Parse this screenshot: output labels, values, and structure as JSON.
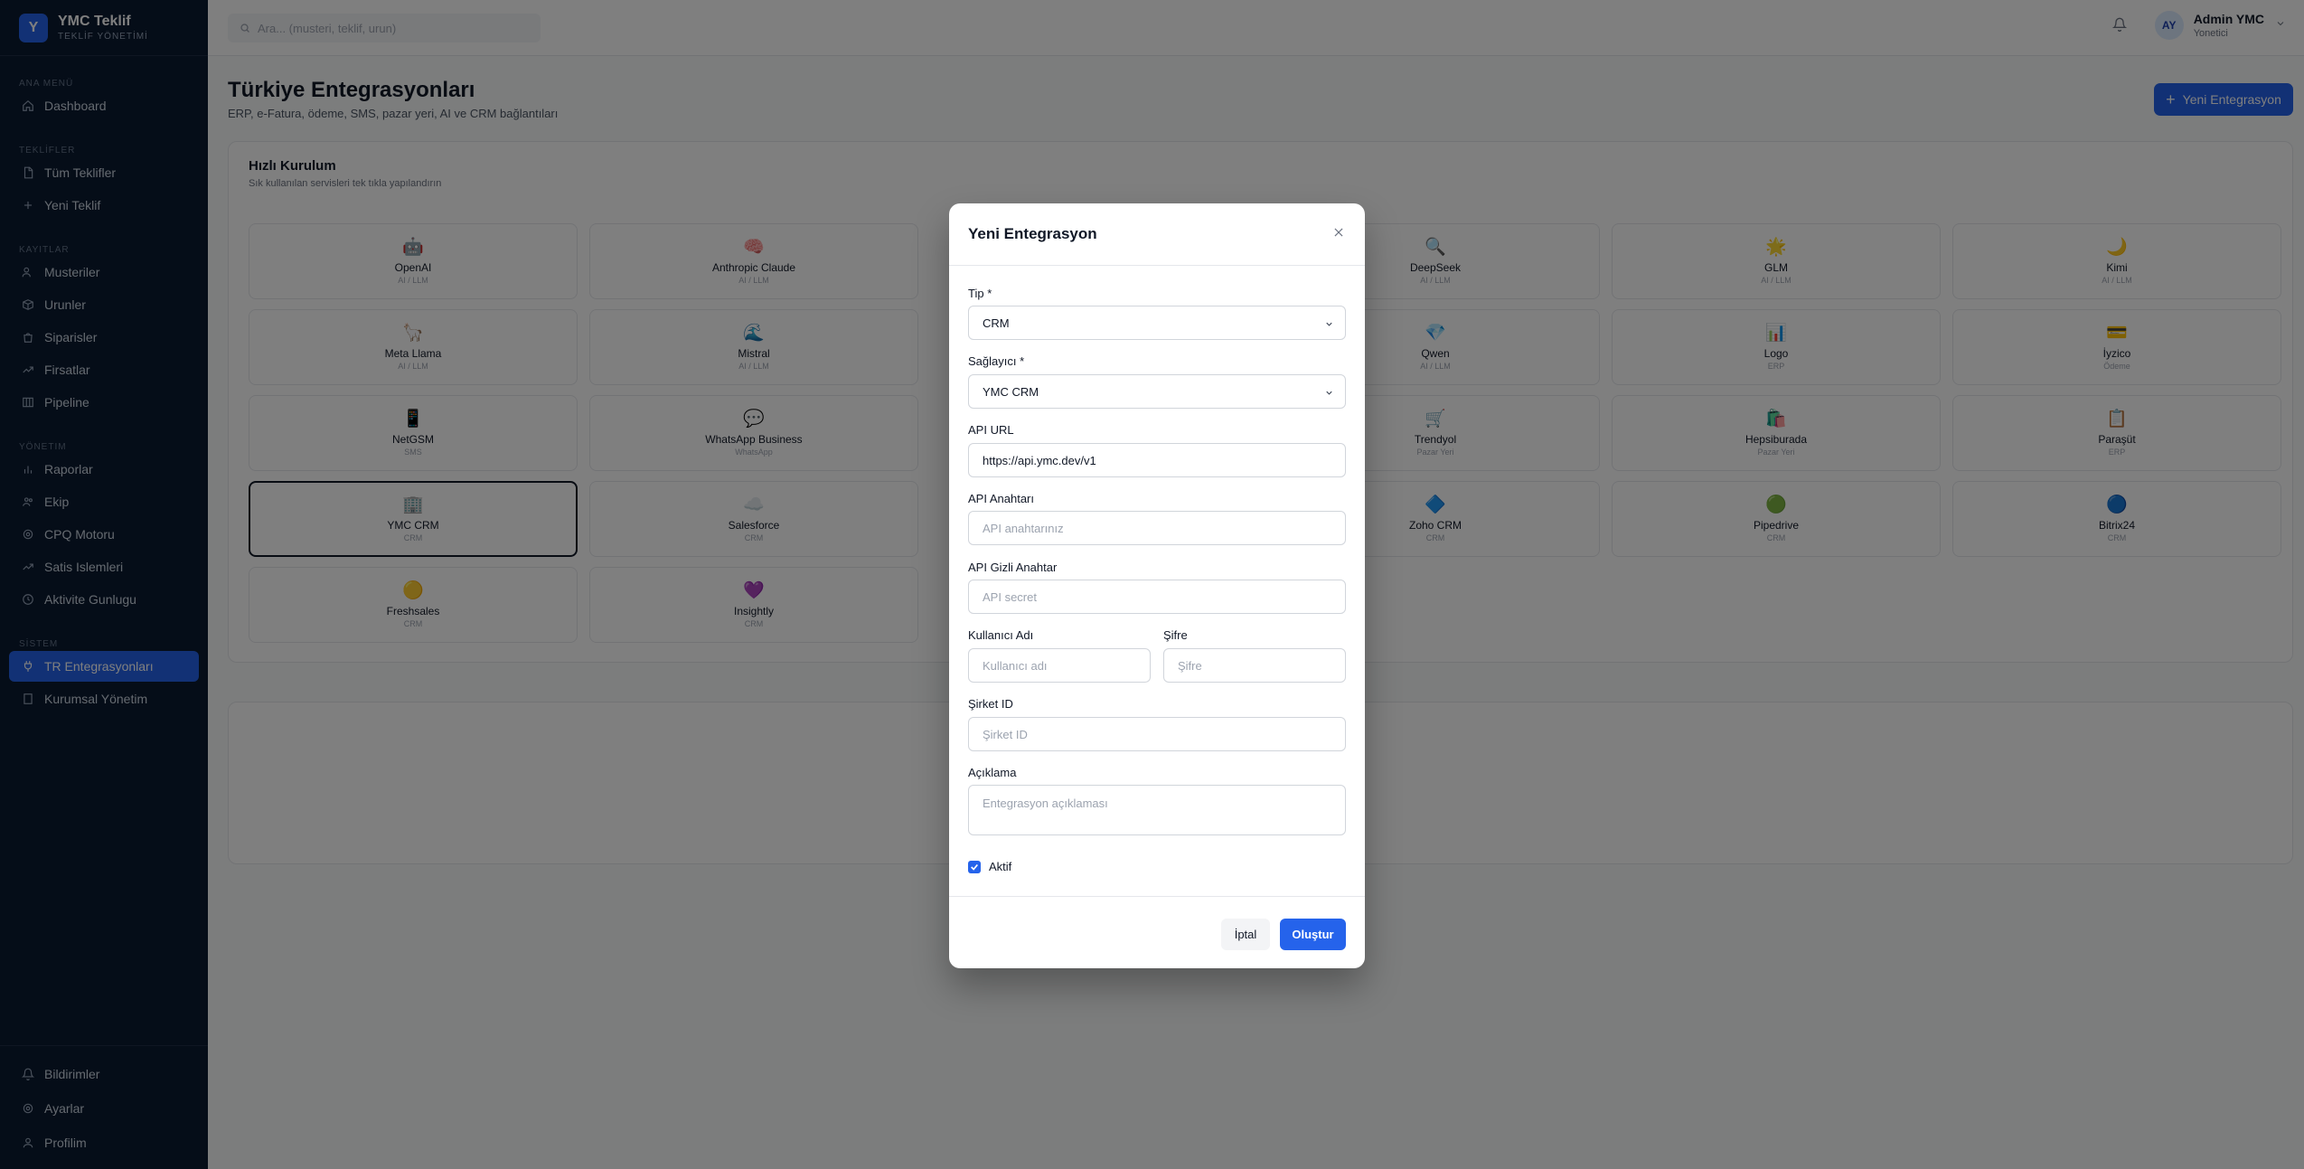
{
  "brand": {
    "logo_letter": "Y",
    "name": "YMC Teklif",
    "subtitle": "TEKLİF YÖNETİMİ"
  },
  "sidebar": {
    "sections": [
      {
        "label": "ANA MENÜ",
        "items": [
          {
            "label": "Dashboard",
            "icon": "home-icon"
          }
        ]
      },
      {
        "label": "TEKLİFLER",
        "items": [
          {
            "label": "Tüm Teklifler",
            "icon": "file-icon"
          },
          {
            "label": "Yeni Teklif",
            "icon": "plus-icon"
          }
        ]
      },
      {
        "label": "KAYITLAR",
        "items": [
          {
            "label": "Musteriler",
            "icon": "users-icon"
          },
          {
            "label": "Urunler",
            "icon": "box-icon"
          },
          {
            "label": "Siparisler",
            "icon": "bag-icon"
          },
          {
            "label": "Firsatlar",
            "icon": "trend-icon"
          },
          {
            "label": "Pipeline",
            "icon": "columns-icon"
          }
        ]
      },
      {
        "label": "YÖNETIM",
        "items": [
          {
            "label": "Raporlar",
            "icon": "chart-icon"
          },
          {
            "label": "Ekip",
            "icon": "team-icon"
          },
          {
            "label": "CPQ Motoru",
            "icon": "gear-icon"
          },
          {
            "label": "Satis Islemleri",
            "icon": "trend-icon"
          },
          {
            "label": "Aktivite Gunlugu",
            "icon": "clock-icon"
          }
        ]
      },
      {
        "label": "SİSTEM",
        "items": [
          {
            "label": "TR Entegrasyonları",
            "icon": "plug-icon",
            "active": true
          },
          {
            "label": "Kurumsal Yönetim",
            "icon": "building-icon"
          }
        ]
      }
    ],
    "bottom": [
      {
        "label": "Bildirimler",
        "icon": "bell-icon"
      },
      {
        "label": "Ayarlar",
        "icon": "gear-icon"
      },
      {
        "label": "Profilim",
        "icon": "user-icon"
      }
    ]
  },
  "topbar": {
    "search_placeholder": "Ara... (musteri, teklif, urun)",
    "user_initials": "AY",
    "user_name": "Admin YMC",
    "user_role": "Yonetici"
  },
  "page": {
    "title": "Türkiye Entegrasyonları",
    "subtitle": "ERP, e-Fatura, ödeme, SMS, pazar yeri, AI ve CRM bağlantıları",
    "new_button": "Yeni Entegrasyon"
  },
  "quick_setup": {
    "title": "Hızlı Kurulum",
    "subtitle": "Sık kullanılan servisleri tek tıkla yapılandırın",
    "tiles": [
      {
        "name": "OpenAI",
        "category": "AI / LLM",
        "emoji": "🤖",
        "col": 0,
        "row": 0
      },
      {
        "name": "Anthropic Claude",
        "category": "AI / LLM",
        "emoji": "🧠",
        "col": 1,
        "row": 0
      },
      {
        "name": "DeepSeek",
        "category": "AI / LLM",
        "emoji": "🔍",
        "col": 3,
        "row": 0
      },
      {
        "name": "GLM",
        "category": "AI / LLM",
        "emoji": "🌟",
        "col": 4,
        "row": 0
      },
      {
        "name": "Kimi",
        "category": "AI / LLM",
        "emoji": "🌙",
        "col": 5,
        "row": 0
      },
      {
        "name": "Meta Llama",
        "category": "AI / LLM",
        "emoji": "🦙",
        "col": 0,
        "row": 1
      },
      {
        "name": "Mistral",
        "category": "AI / LLM",
        "emoji": "🌊",
        "col": 1,
        "row": 1
      },
      {
        "name": "Qwen",
        "category": "AI / LLM",
        "emoji": "💎",
        "col": 3,
        "row": 1
      },
      {
        "name": "Logo",
        "category": "ERP",
        "emoji": "📊",
        "col": 4,
        "row": 1
      },
      {
        "name": "İyzico",
        "category": "Ödeme",
        "emoji": "💳",
        "col": 5,
        "row": 1
      },
      {
        "name": "NetGSM",
        "category": "SMS",
        "emoji": "📱",
        "col": 0,
        "row": 2
      },
      {
        "name": "WhatsApp Business",
        "category": "WhatsApp",
        "emoji": "💬",
        "col": 1,
        "row": 2
      },
      {
        "name": "Trendyol",
        "category": "Pazar Yeri",
        "emoji": "🛒",
        "col": 3,
        "row": 2
      },
      {
        "name": "Hepsiburada",
        "category": "Pazar Yeri",
        "emoji": "🛍️",
        "col": 4,
        "row": 2
      },
      {
        "name": "Paraşüt",
        "category": "ERP",
        "emoji": "📋",
        "col": 5,
        "row": 2
      },
      {
        "name": "YMC CRM",
        "category": "CRM",
        "emoji": "🏢",
        "col": 0,
        "row": 3,
        "selected": true
      },
      {
        "name": "Salesforce",
        "category": "CRM",
        "emoji": "☁️",
        "col": 1,
        "row": 3
      },
      {
        "name": "Zoho CRM",
        "category": "CRM",
        "emoji": "🔷",
        "col": 3,
        "row": 3
      },
      {
        "name": "Pipedrive",
        "category": "CRM",
        "emoji": "🟢",
        "col": 4,
        "row": 3
      },
      {
        "name": "Bitrix24",
        "category": "CRM",
        "emoji": "🔵",
        "col": 5,
        "row": 3
      },
      {
        "name": "Freshsales",
        "category": "CRM",
        "emoji": "🟡",
        "col": 0,
        "row": 4
      },
      {
        "name": "Insightly",
        "category": "CRM",
        "emoji": "💜",
        "col": 1,
        "row": 4
      }
    ]
  },
  "modal": {
    "title": "Yeni Entegrasyon",
    "type_label": "Tip *",
    "type_value": "CRM",
    "provider_label": "Sağlayıcı *",
    "provider_value": "YMC CRM",
    "api_url_label": "API URL",
    "api_url_value": "https://api.ymc.dev/v1",
    "api_key_label": "API Anahtarı",
    "api_key_placeholder": "API anahtarınız",
    "api_secret_label": "API Gizli Anahtar",
    "api_secret_placeholder": "API secret",
    "username_label": "Kullanıcı Adı",
    "username_placeholder": "Kullanıcı adı",
    "password_label": "Şifre",
    "password_placeholder": "Şifre",
    "company_label": "Şirket ID",
    "company_placeholder": "Şirket ID",
    "description_label": "Açıklama",
    "description_placeholder": "Entegrasyon açıklaması",
    "active_label": "Aktif",
    "active_checked": true,
    "cancel_label": "İptal",
    "create_label": "Oluştur"
  },
  "colors": {
    "accent": "#2563eb",
    "sidebar_bg": "#0b1a30"
  }
}
